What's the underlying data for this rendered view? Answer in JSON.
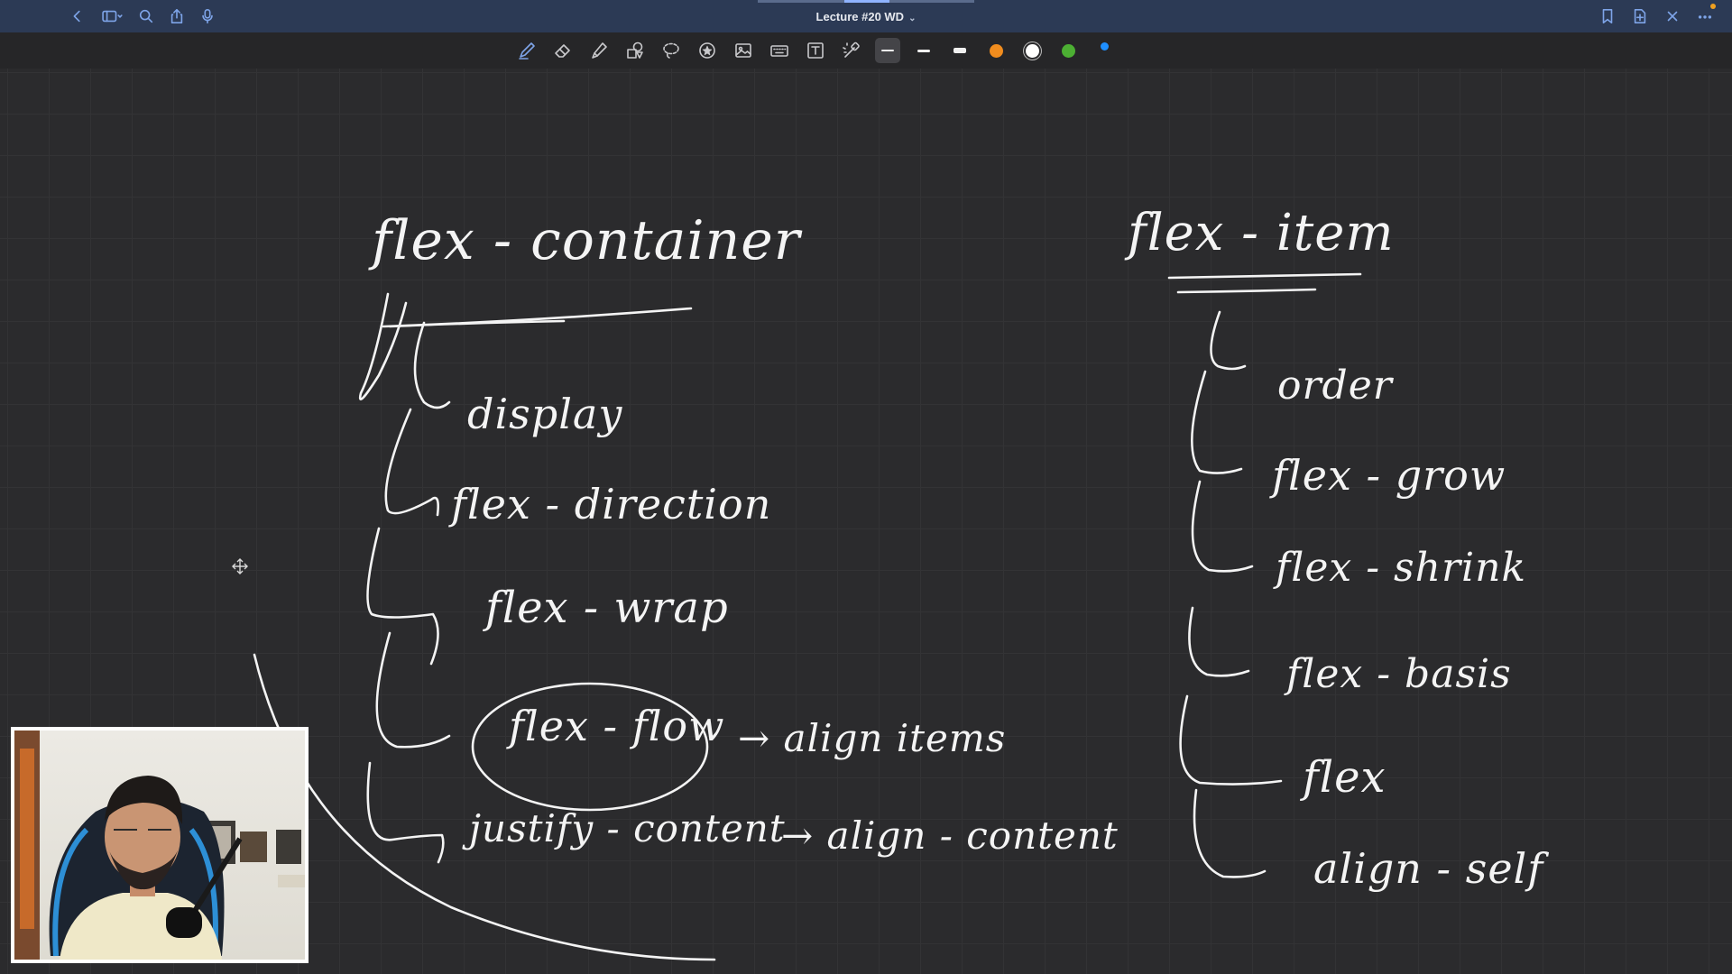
{
  "window": {
    "title": "Lecture #20 WD",
    "title_chevron": "⌄",
    "left_icons": [
      "back-icon",
      "sidebar-toggle-icon",
      "search-icon",
      "share-icon",
      "microphone-icon"
    ],
    "right_icons": [
      "bookmark-icon",
      "add-page-icon",
      "close-icon",
      "more-icon"
    ]
  },
  "toolbar": {
    "tools": [
      "pen-icon",
      "eraser-icon",
      "highlighter-icon",
      "shapes-icon",
      "lasso-icon",
      "sticker-icon",
      "image-icon",
      "keyboard-icon",
      "text-box-icon",
      "laser-pointer-icon"
    ],
    "active_tool": "pen-icon",
    "stroke_widths": [
      "thin",
      "medium",
      "thick"
    ],
    "selected_stroke_width": "thin",
    "colors": [
      "#f08c1e",
      "#ffffff",
      "#4caf33"
    ],
    "selected_color": "#ffffff",
    "accent_dot_color": "#1f8fff"
  },
  "notes": {
    "left_heading": "flex - container",
    "left_items": [
      "display",
      "flex - direction",
      "flex - wrap",
      "flex - flow",
      "justify - content"
    ],
    "left_side_notes": [
      "→ align items",
      "→ align - content"
    ],
    "right_heading": "flex - item",
    "right_items": [
      "order",
      "flex - grow",
      "flex - shrink",
      "flex - basis",
      "flex",
      "align - self"
    ]
  },
  "webcam": {
    "overlay": "presenter-video"
  }
}
